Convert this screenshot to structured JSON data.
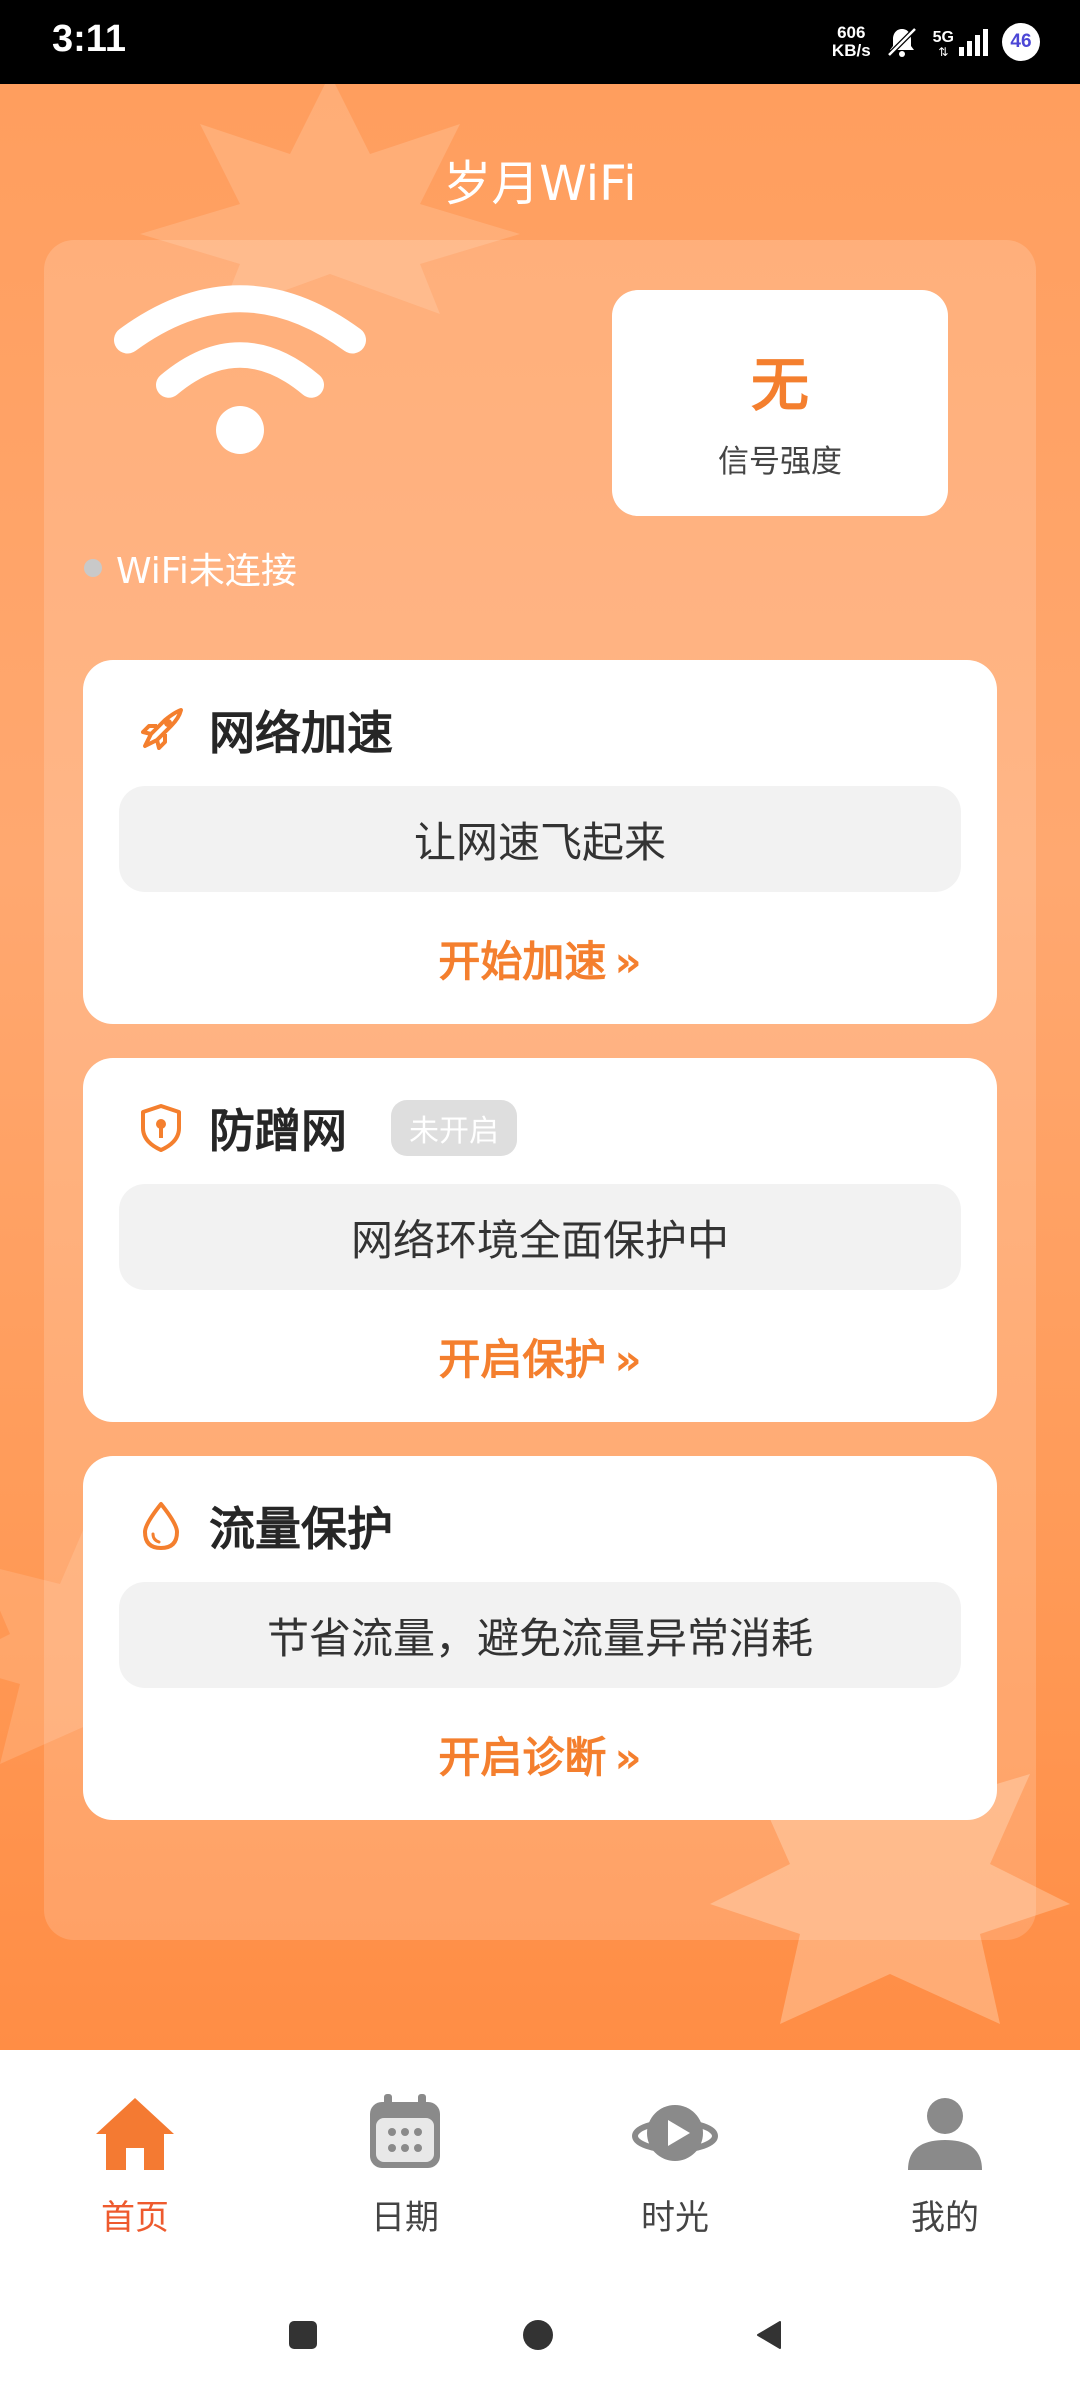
{
  "status_bar": {
    "time": "3:11",
    "net_speed_value": "606",
    "net_speed_unit": "KB/s",
    "network": "5G",
    "battery": "46"
  },
  "app": {
    "title": "岁月WiFi"
  },
  "wifi": {
    "status_text": "WiFi未连接",
    "signal_value": "无",
    "signal_label": "信号强度"
  },
  "cards": [
    {
      "title": "网络加速",
      "icon": "rocket-icon",
      "desc": "让网速飞起来",
      "action": "开始加速"
    },
    {
      "title": "防蹭网",
      "icon": "shield-lock-icon",
      "badge": "未开启",
      "desc": "网络环境全面保护中",
      "action": "开启保护"
    },
    {
      "title": "流量保护",
      "icon": "water-drop-icon",
      "desc": "节省流量，避免流量异常消耗",
      "action": "开启诊断"
    }
  ],
  "bottom_nav": [
    {
      "label": "首页",
      "icon": "home-icon",
      "active": true
    },
    {
      "label": "日期",
      "icon": "calendar-icon",
      "active": false
    },
    {
      "label": "时光",
      "icon": "play-planet-icon",
      "active": false
    },
    {
      "label": "我的",
      "icon": "user-icon",
      "active": false
    }
  ],
  "colors": {
    "accent": "#f47f2e",
    "nav_active": "#ee5a2e",
    "background_orange": "#ffa870"
  }
}
